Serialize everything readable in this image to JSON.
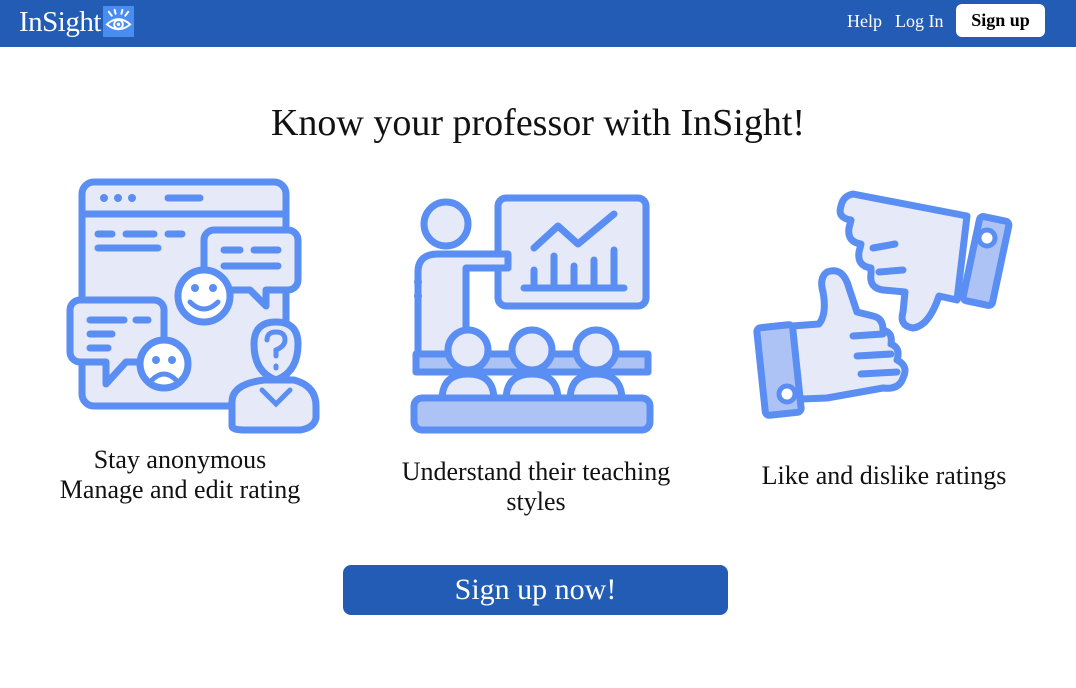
{
  "brand": {
    "name": "InSight",
    "logo_icon": "eye-logo-icon"
  },
  "nav": {
    "help": "Help",
    "login": "Log In",
    "signup": "Sign up"
  },
  "headline": "Know your professor with InSight!",
  "features": [
    {
      "icon": "anonymous-reviews-icon",
      "lines": [
        "Stay anonymous",
        "Manage and edit rating"
      ]
    },
    {
      "icon": "teaching-presentation-icon",
      "lines": [
        "Understand their teaching",
        "styles"
      ]
    },
    {
      "icon": "thumbs-up-down-icon",
      "lines": [
        "Like and dislike ratings"
      ]
    }
  ],
  "cta": {
    "label": "Sign up now!"
  },
  "colors": {
    "brand_blue": "#235cb5",
    "icon_stroke": "#5a8ef2",
    "icon_fill_light": "#e6eaf8",
    "icon_fill_mid": "#aec3f5",
    "background": "#ffffff"
  }
}
